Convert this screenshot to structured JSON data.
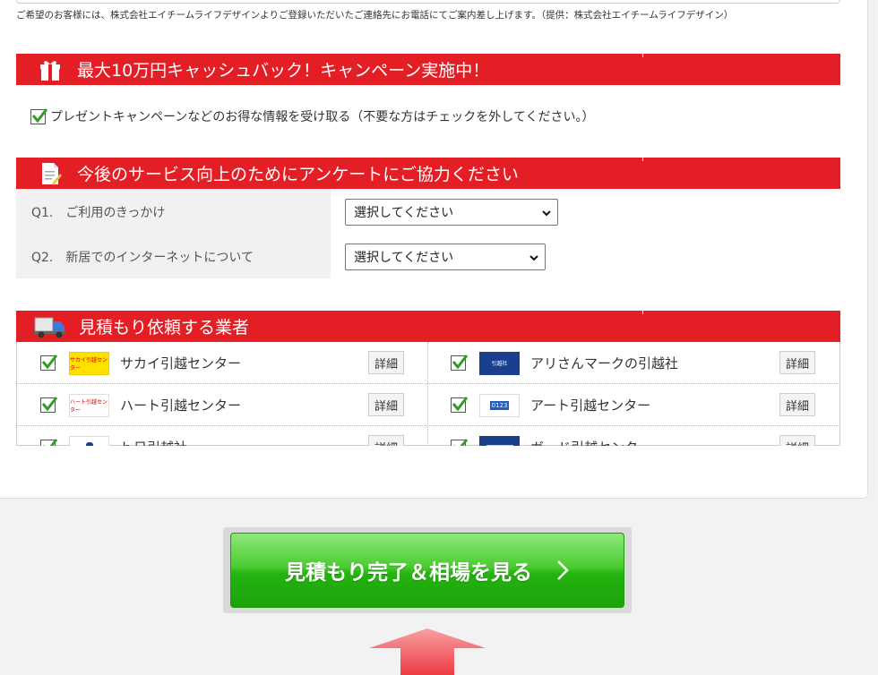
{
  "notice": "ご希望のお客様には、株式会社エイチームライフデザインよりご登録いただいたご連絡先にお電話にてご案内差し上げます。（提供：株式会社エイチームライフデザイン）",
  "campaign": {
    "title": "最大10万円キャッシュバック！キャンペーン実施中！",
    "icon": "gift-icon",
    "checkbox_checked": true,
    "checkbox_label": "プレゼントキャンペーンなどのお得な情報を受け取る（不要な方はチェックを外してください。）"
  },
  "survey": {
    "title": "今後のサービス向上のためにアンケートにご協力ください",
    "icon": "memo-icon",
    "questions": [
      {
        "label": "Q1.　ご利用のきっかけ",
        "value": "選択してください"
      },
      {
        "label": "Q2.　新居でのインターネットについて",
        "value": "選択してください"
      }
    ]
  },
  "movers": {
    "title": "見積もり依頼する業者",
    "icon": "truck-icon",
    "detail_label": "詳細",
    "rows": [
      [
        {
          "name": "サカイ引越センター",
          "checked": true,
          "logo_text": "サカイ引越センター"
        },
        {
          "name": "アリさんマークの引越社",
          "checked": true,
          "logo_text": "引越社"
        }
      ],
      [
        {
          "name": "ハート引越センター",
          "checked": true,
          "logo_text": "ハート引越センター"
        },
        {
          "name": "アート引越センター",
          "checked": true,
          "logo_text": "0123"
        }
      ],
      [
        {
          "name": "ｈ日引越社",
          "checked": true,
          "logo_text": ""
        },
        {
          "name": "ガード引越センター",
          "checked": true,
          "logo_text": ""
        }
      ]
    ]
  },
  "cta": {
    "label": "見積もり完了＆相場を見る",
    "chevron": "chevron-right-icon"
  },
  "colors": {
    "brand_red": "#e31e24",
    "cta_green": "#33bb1e",
    "check_green": "#2f9e22",
    "arrow_red": "#f0525a"
  }
}
